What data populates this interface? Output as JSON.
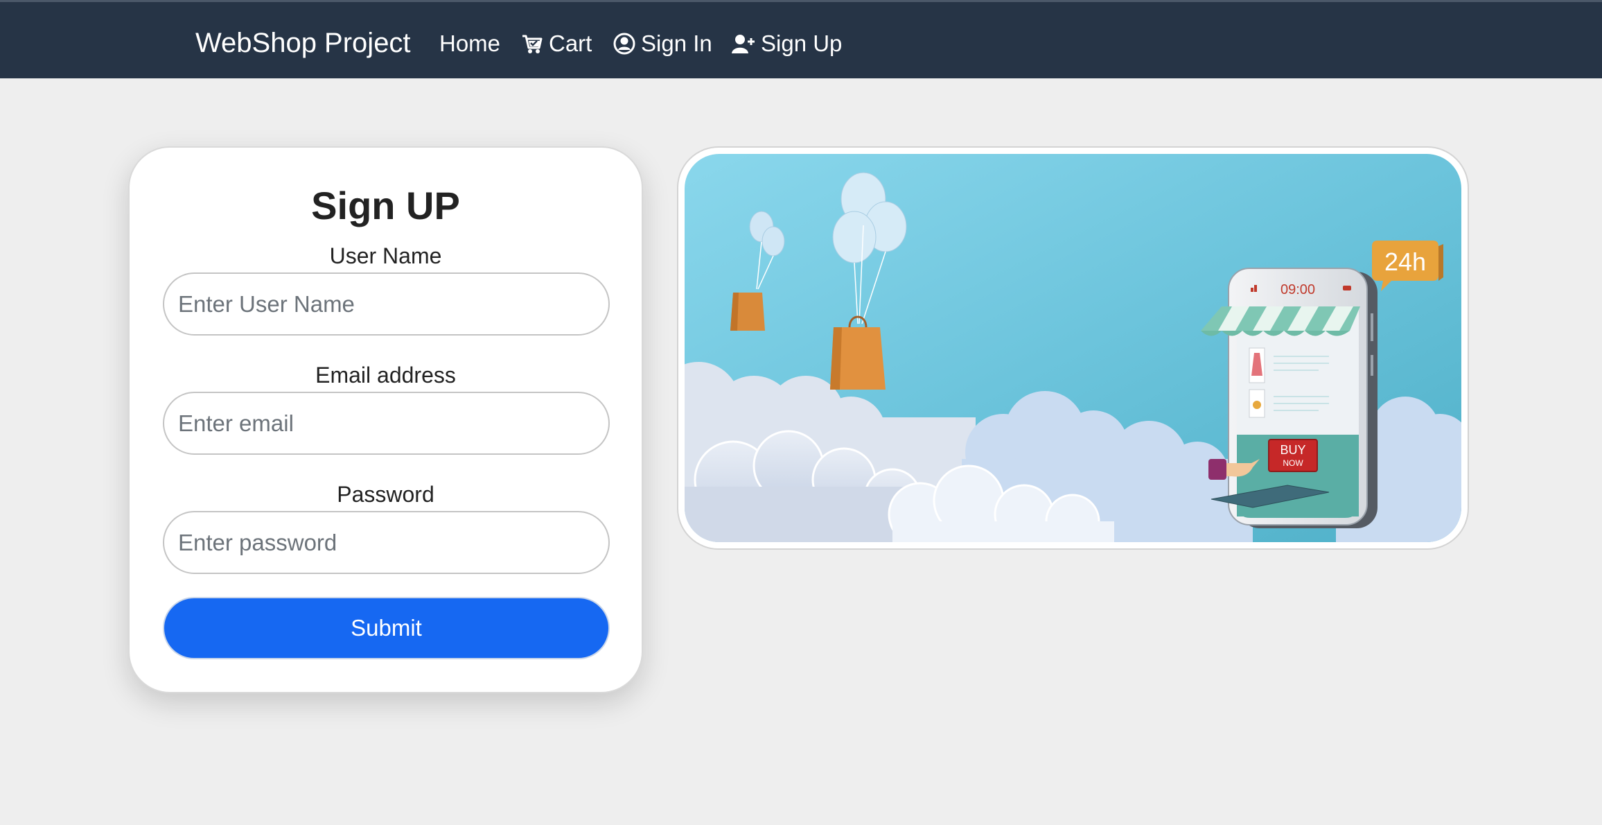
{
  "navbar": {
    "brand": "WebShop Project",
    "links": [
      {
        "label": "Home",
        "icon": ""
      },
      {
        "label": "Cart",
        "icon": "cart-icon"
      },
      {
        "label": "Sign In",
        "icon": "user-circle-icon"
      },
      {
        "label": "Sign Up",
        "icon": "user-plus-icon"
      }
    ]
  },
  "form": {
    "title": "Sign UP",
    "fields": [
      {
        "label": "User Name",
        "placeholder": "Enter User Name",
        "value": ""
      },
      {
        "label": "Email address",
        "placeholder": "Enter email",
        "value": ""
      },
      {
        "label": "Password",
        "placeholder": "Enter password",
        "value": ""
      }
    ],
    "submit_label": "Submit"
  },
  "banner": {
    "phone_time": "09:00",
    "badge_text": "24h",
    "buy_text": "BUY",
    "now_text": "NOW"
  },
  "colors": {
    "navbar_bg": "#263446",
    "page_bg": "#eeeeee",
    "primary_button": "#1668f2"
  }
}
